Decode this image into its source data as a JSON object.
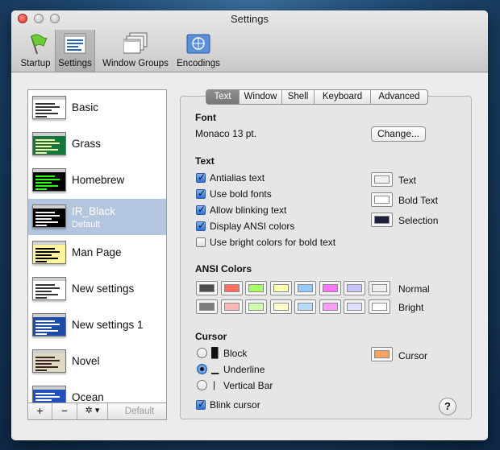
{
  "window": {
    "title": "Settings"
  },
  "toolbar": [
    {
      "label": "Startup",
      "icon": "flag-icon"
    },
    {
      "label": "Settings",
      "icon": "settings-icon",
      "selected": true
    },
    {
      "label": "Window Groups",
      "icon": "window-groups-icon"
    },
    {
      "label": "Encodings",
      "icon": "encodings-icon"
    }
  ],
  "profiles": [
    {
      "name": "Basic",
      "bg": "#ffffff",
      "fg": "#333333"
    },
    {
      "name": "Grass",
      "bg": "#13773d",
      "fg": "#fff0a5"
    },
    {
      "name": "Homebrew",
      "bg": "#000000",
      "fg": "#28fe14"
    },
    {
      "name": "IR_Black",
      "bg": "#000000",
      "fg": "#f1f1f1",
      "selected": true,
      "default_label": "Default"
    },
    {
      "name": "Man Page",
      "bg": "#fef49c",
      "fg": "#000000"
    },
    {
      "name": "New settings",
      "bg": "#ffffff",
      "fg": "#333333"
    },
    {
      "name": "New settings 1",
      "bg": "#1e4aa8",
      "fg": "#ffffff"
    },
    {
      "name": "Novel",
      "bg": "#dfdbc3",
      "fg": "#3b2322"
    },
    {
      "name": "Ocean",
      "bg": "#224fbc",
      "fg": "#ffffff"
    }
  ],
  "list_footer": {
    "add": "+",
    "remove": "−",
    "action": "✲ ▾",
    "default": "Default"
  },
  "tabs": [
    {
      "label": "Text",
      "active": true
    },
    {
      "label": "Window"
    },
    {
      "label": "Shell"
    },
    {
      "label": "Keyboard"
    },
    {
      "label": "Advanced"
    }
  ],
  "font": {
    "heading": "Font",
    "value": "Monaco 13 pt.",
    "change_button": "Change..."
  },
  "text": {
    "heading": "Text",
    "options": [
      {
        "label": "Antialias text",
        "checked": true
      },
      {
        "label": "Use bold fonts",
        "checked": true
      },
      {
        "label": "Allow blinking text",
        "checked": true
      },
      {
        "label": "Display ANSI colors",
        "checked": true
      },
      {
        "label": "Use bright colors for bold text",
        "checked": false
      }
    ],
    "colors": [
      {
        "label": "Text",
        "color": "#f1f1f1"
      },
      {
        "label": "Bold Text",
        "color": "#ffffff"
      },
      {
        "label": "Selection",
        "color": "#1d1e3e"
      }
    ]
  },
  "ansi": {
    "heading": "ANSI Colors",
    "normal_label": "Normal",
    "bright_label": "Bright",
    "normal": [
      "#4e4e4e",
      "#ff6c60",
      "#a8ff60",
      "#ffffb6",
      "#96cbfe",
      "#ff73fd",
      "#c6c5fe",
      "#eeeeee"
    ],
    "bright": [
      "#7c7c7c",
      "#ffb6b0",
      "#ceffac",
      "#ffffcb",
      "#b5dcfe",
      "#ff9cfe",
      "#dfdffe",
      "#ffffff"
    ]
  },
  "cursor": {
    "heading": "Cursor",
    "styles": [
      {
        "glyph": "█",
        "label": "Block",
        "selected": false
      },
      {
        "glyph": "▁",
        "label": "Underline",
        "selected": true
      },
      {
        "glyph": "|",
        "label": "Vertical Bar",
        "selected": false
      }
    ],
    "color_label": "Cursor",
    "color": "#f4a460",
    "blink_label": "Blink cursor",
    "blink": true
  },
  "help_label": "?"
}
